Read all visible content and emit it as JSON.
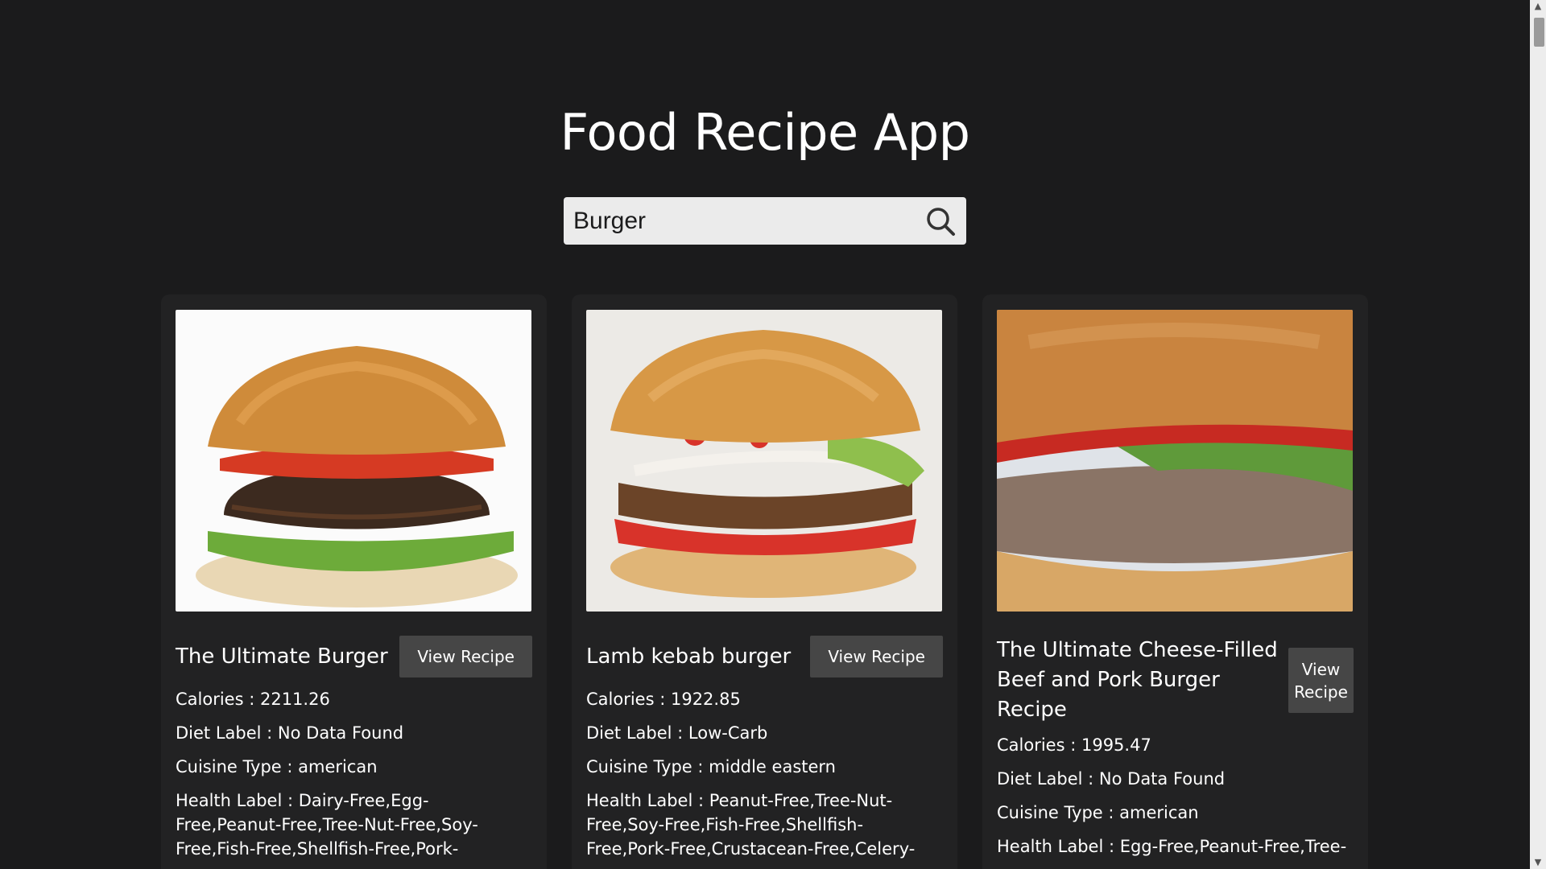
{
  "app": {
    "title": "Food Recipe App"
  },
  "search": {
    "value": "Burger",
    "icon": "search-icon"
  },
  "recipes": [
    {
      "name": "The Ultimate Burger",
      "button": "View Recipe",
      "calories": "Calories : 2211.26",
      "diet": "Diet Label : No Data Found",
      "cuisine": "Cuisine Type : american",
      "health": "Health Label : Dairy-Free,Egg-Free,Peanut-Free,Tree-Nut-Free,Soy-Free,Fish-Free,Shellfish-Free,Pork-"
    },
    {
      "name": "Lamb kebab burger",
      "button": "View Recipe",
      "calories": "Calories : 1922.85",
      "diet": "Diet Label : Low-Carb",
      "cuisine": "Cuisine Type : middle eastern",
      "health": "Health Label : Peanut-Free,Tree-Nut-Free,Soy-Free,Fish-Free,Shellfish-Free,Pork-Free,Crustacean-Free,Celery-"
    },
    {
      "name": "The Ultimate Cheese-Filled Beef and Pork Burger Recipe",
      "button": "View Recipe",
      "calories": "Calories : 1995.47",
      "diet": "Diet Label : No Data Found",
      "cuisine": "Cuisine Type : american",
      "health": "Health Label : Egg-Free,Peanut-Free,Tree-"
    }
  ],
  "colors": {
    "background": "#1b1b1c",
    "card": "#222223",
    "button": "#464646",
    "search": "#ebebeb"
  }
}
